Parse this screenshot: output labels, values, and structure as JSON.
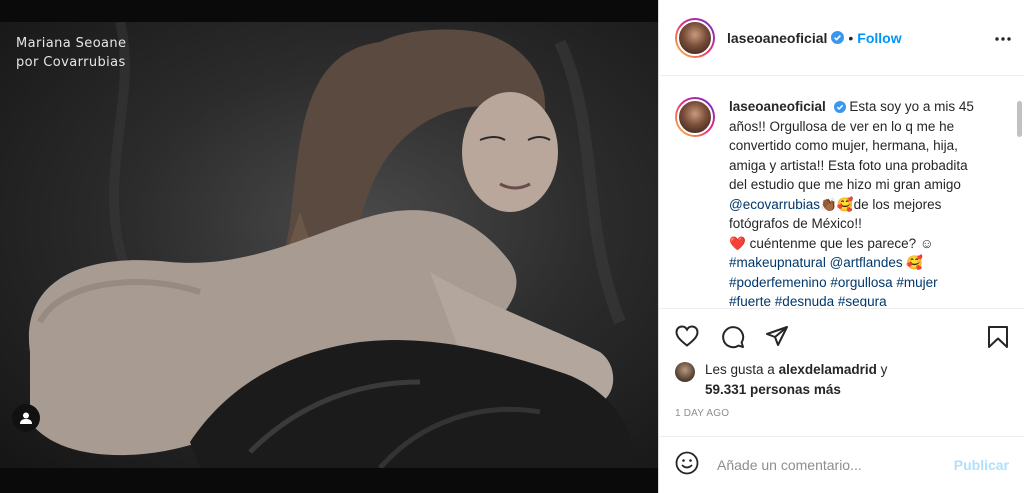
{
  "photo": {
    "watermark_line1": "Mariana Seoane",
    "watermark_line2": "por Covarrubias"
  },
  "header": {
    "username": "laseoaneoficial",
    "separator": "•",
    "follow_label": "Follow"
  },
  "caption": {
    "username": "laseoaneoficial",
    "text_part1": "Esta soy yo a mis 45 años!! Orgullosa de ver en lo q me he convertido como mujer, hermana, hija, amiga y artista!! Esta foto una probadita del estudio que me hizo mi gran amigo ",
    "mention1": "@ecovarrubias",
    "emoji1": "👏🏾🥰",
    "text_part2": "de los mejores fotógrafos de México!!",
    "heart": "❤️",
    "text_part3": " cuéntenme que les parece? ☺",
    "hashtag1": "#makeupnatural",
    "mention2": "@artflandes",
    "emoji2": " 🥰",
    "hashtag2": "#poderfemenino",
    "hashtag3": "#orgullosa",
    "hashtag4": "#mujer",
    "hashtag5": "#fuerte",
    "hashtag6": "#desnuda",
    "hashtag7": "#segura"
  },
  "likes": {
    "prefix": "Les gusta a ",
    "user": "alexdelamadrid",
    "middle": " y",
    "count": "59.331 personas más"
  },
  "time": "1 DAY AGO",
  "comment": {
    "placeholder": "Añade un comentario...",
    "publish_label": "Publicar"
  },
  "colors": {
    "accent": "#0095f6",
    "link": "#00376b",
    "publish_disabled": "#b2dffc",
    "heart": "#ed4956"
  }
}
